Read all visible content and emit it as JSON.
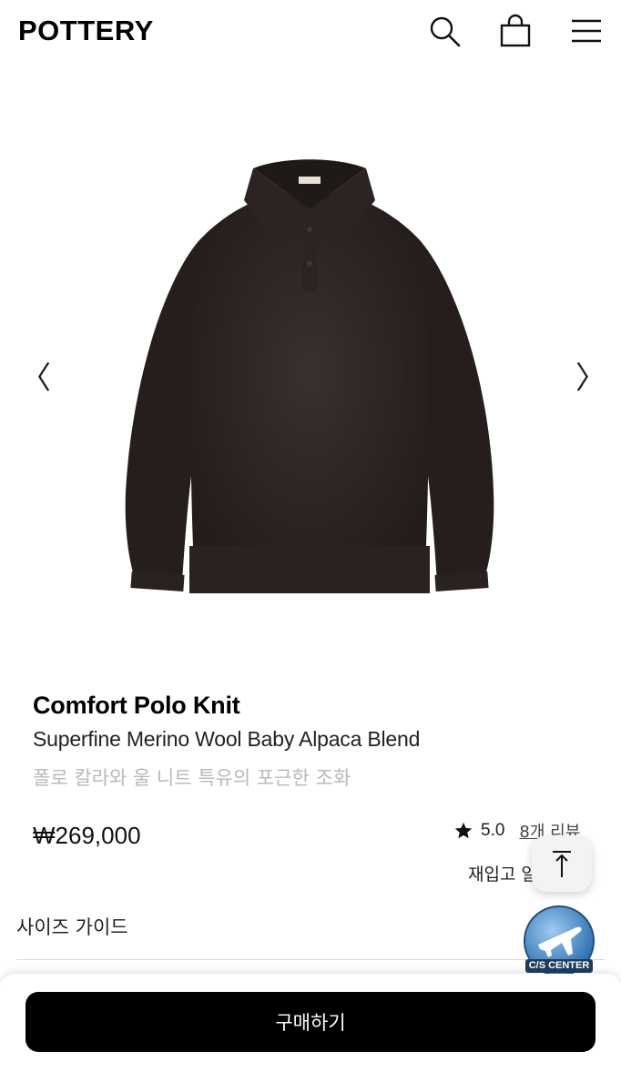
{
  "header": {
    "logo": "POTTERY",
    "icons": [
      "search-icon",
      "shopping-bag-icon",
      "menu-icon"
    ]
  },
  "gallery": {
    "prev_label": "〈",
    "next_label": "〉"
  },
  "product": {
    "name": "Comfort Polo Knit",
    "subtitle": "Superfine Merino Wool Baby Alpaca Blend",
    "description": "폴로 칼라와 울 니트 특유의 포근한 조화",
    "price": "₩269,000",
    "rating": "5.0",
    "reviews": "8개 리뷰",
    "restock": "재입고 알림 신청",
    "size_guide": "사이즈 가이드"
  },
  "floating": {
    "cs_label": "C/S CENTER"
  },
  "bottom": {
    "buy_label": "구매하기"
  },
  "colors": {
    "sweater": "#2e2624",
    "button_bg": "#000000",
    "muted_text": "#b9b9b9"
  }
}
